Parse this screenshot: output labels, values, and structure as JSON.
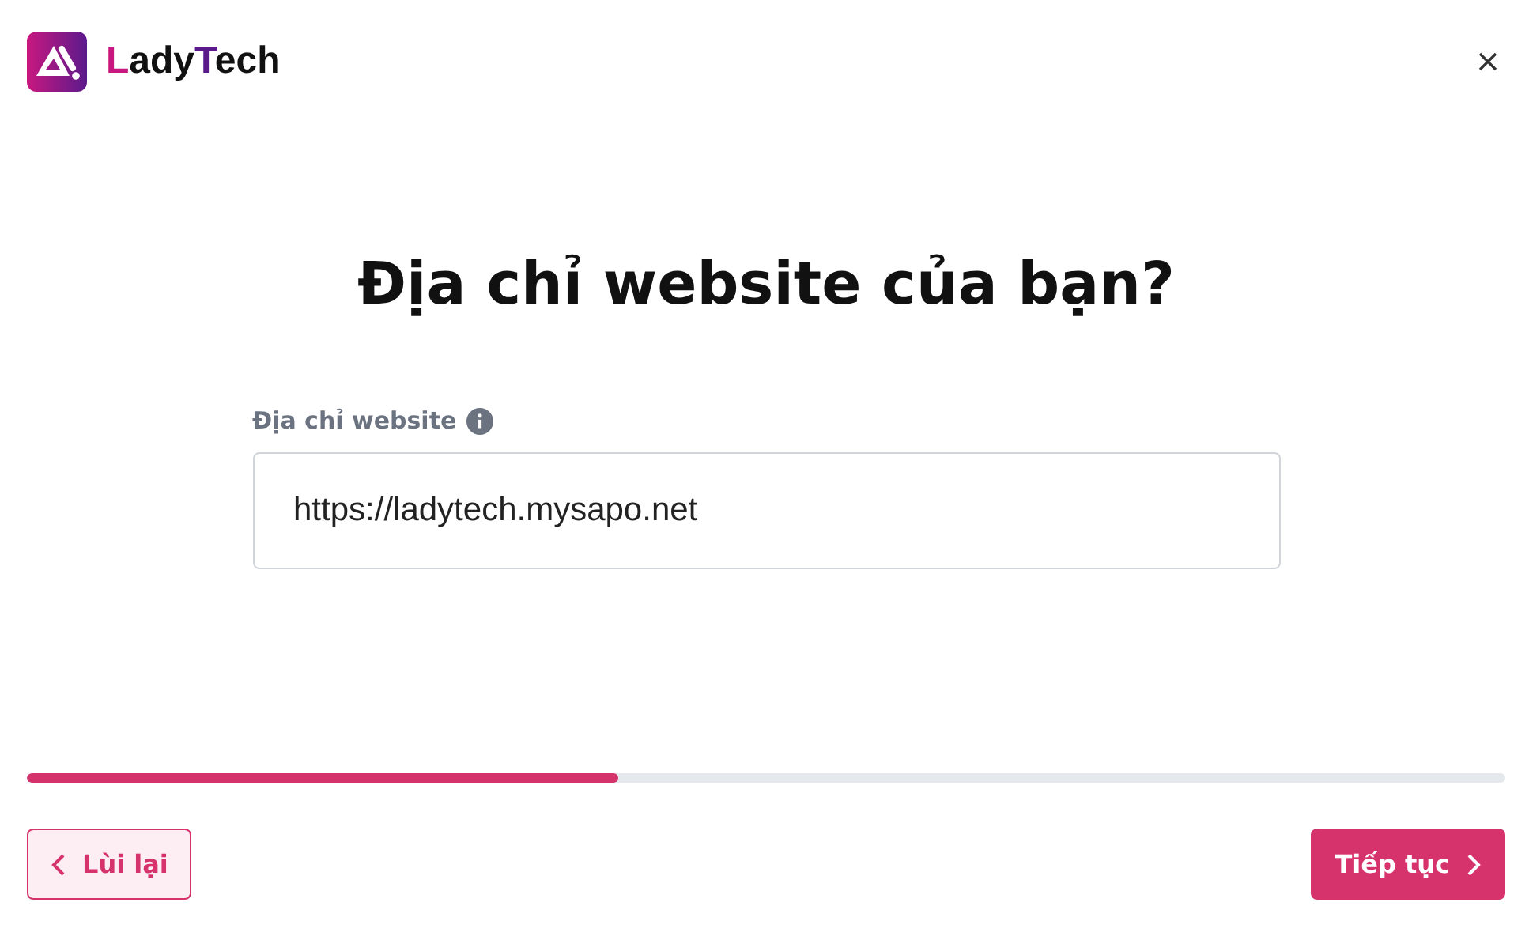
{
  "brand": {
    "segments": [
      {
        "text": "L",
        "color": "#c8187f"
      },
      {
        "text": "ady",
        "color": "#111111"
      },
      {
        "text": "T",
        "color": "#5b1a8c"
      },
      {
        "text": "ech",
        "color": "#111111"
      }
    ]
  },
  "title": "Địa chỉ website của bạn?",
  "field": {
    "label": "Địa chỉ website",
    "value": "https://ladytech.mysapo.net"
  },
  "progress": {
    "level": 0.4
  },
  "buttons": {
    "back": "Lùi lại",
    "next": "Tiếp tục"
  }
}
